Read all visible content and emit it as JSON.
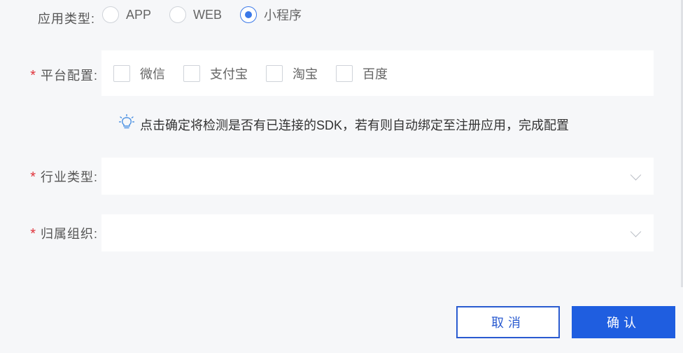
{
  "app_type": {
    "label": "应用类型:",
    "options": [
      {
        "label": "APP",
        "checked": false
      },
      {
        "label": "WEB",
        "checked": false
      },
      {
        "label": "小程序",
        "checked": true
      }
    ]
  },
  "platform": {
    "label": "平台配置:",
    "required_mark": "*",
    "options": [
      "微信",
      "支付宝",
      "淘宝",
      "百度"
    ]
  },
  "hint": {
    "icon": "lightbulb-icon",
    "text": "点击确定将检测是否有已连接的SDK，若有则自动绑定至注册应用，完成配置"
  },
  "industry": {
    "label": "行业类型:",
    "required_mark": "*",
    "value": ""
  },
  "organization": {
    "label": "归属组织:",
    "required_mark": "*",
    "value": ""
  },
  "buttons": {
    "cancel": "取消",
    "confirm": "确认"
  },
  "colors": {
    "accent": "#1f5ee0",
    "required": "#e0333b",
    "radio_checked": "#3a78e8"
  }
}
